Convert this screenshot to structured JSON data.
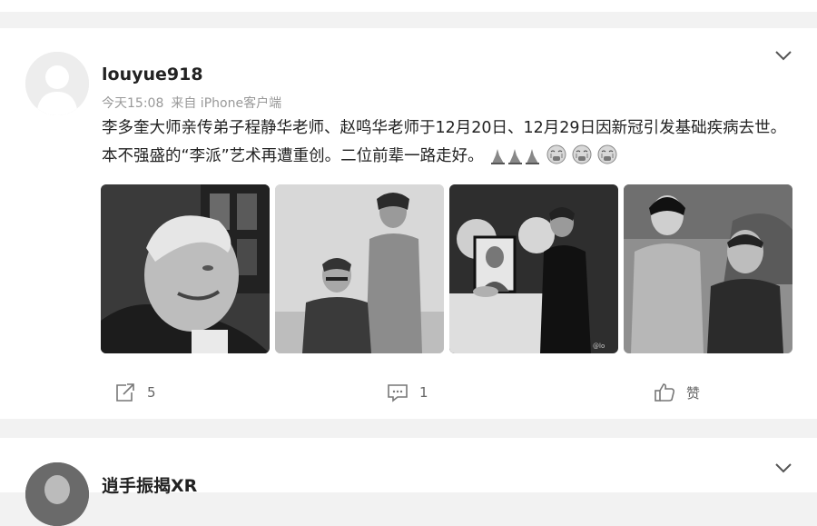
{
  "post": {
    "username": "louyue918",
    "time": "今天15:08",
    "source": "来自 iPhone客户端",
    "text": "李多奎大师亲传弟子程静华老师、赵鸣华老师于12月20日、12月29日因新冠引发基础疾病去世。本不强盛的“李派”艺术再遭重创。二位前辈一路走好。",
    "emoji": [
      "candle-emoji",
      "candle-emoji",
      "candle-emoji",
      "crying-face-emoji",
      "crying-face-emoji",
      "crying-face-emoji"
    ],
    "photos": [
      {
        "name": "photo-elderly-man-smiling"
      },
      {
        "name": "photo-seated-man-standing-woman"
      },
      {
        "name": "photo-woman-beside-portrait"
      },
      {
        "name": "photo-woman-and-man-standing"
      }
    ],
    "photo_watermark": "@lo",
    "actions": {
      "repost_count": "5",
      "comment_count": "1",
      "like_label": "赞"
    }
  },
  "next_post": {
    "username": "逍手振揭XR"
  },
  "colors": {
    "background": "#f2f2f2",
    "card": "#ffffff",
    "meta_text": "#999999",
    "action_text": "#666666"
  }
}
